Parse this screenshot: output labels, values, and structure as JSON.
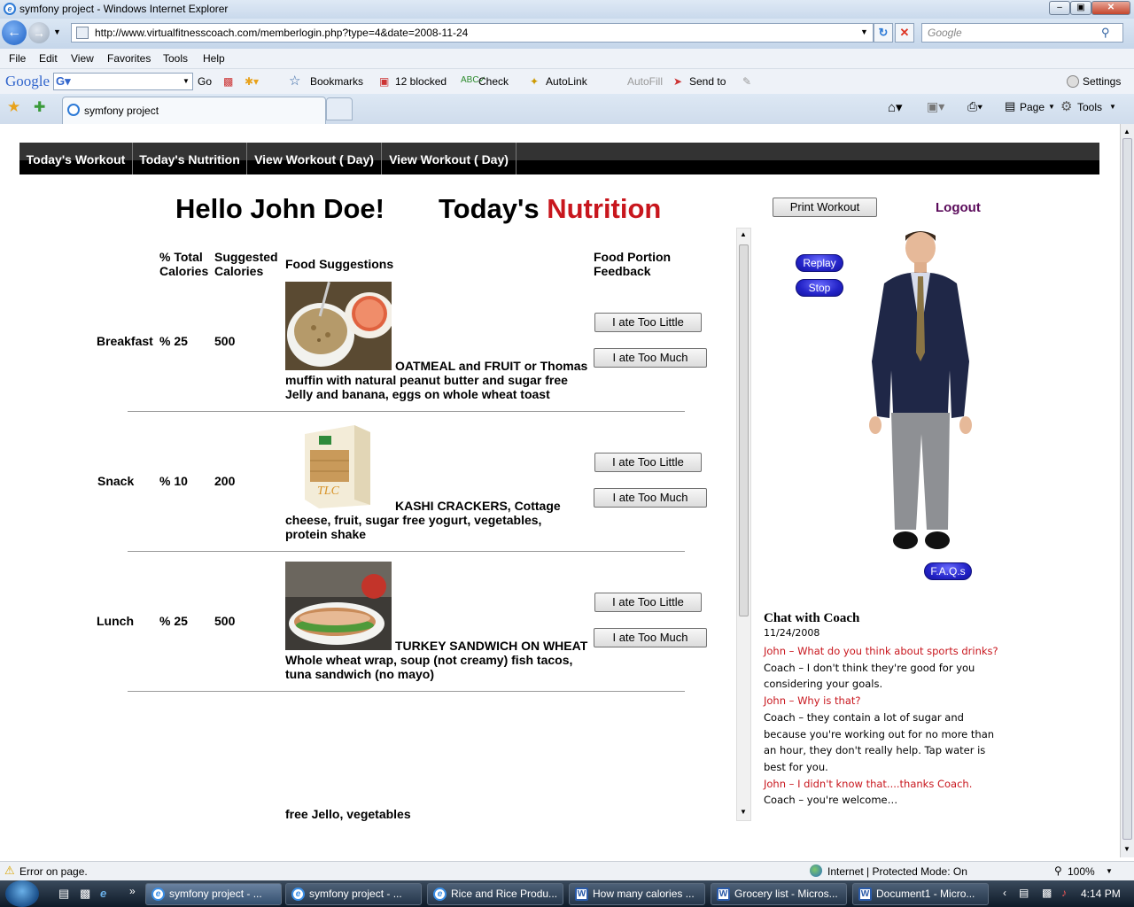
{
  "window": {
    "title": "symfony project - Windows Internet Explorer"
  },
  "address": {
    "url": "http://www.virtualfitnesscoach.com/memberlogin.php?type=4&date=2008-11-24",
    "search_placeholder": "Google"
  },
  "menu": [
    "File",
    "Edit",
    "View",
    "Favorites",
    "Tools",
    "Help"
  ],
  "google_toolbar": {
    "logo": "Google",
    "go": "Go",
    "bookmarks": "Bookmarks",
    "blocked": "12 blocked",
    "check": "Check",
    "autolink": "AutoLink",
    "autofill": "AutoFill",
    "sendto": "Send to",
    "settings": "Settings"
  },
  "tabs": {
    "active": "symfony project"
  },
  "command_bar": {
    "page": "Page",
    "tools": "Tools"
  },
  "site_nav": [
    "Today's Workout",
    "Today's Nutrition",
    "View Workout ( Day)",
    "View Workout ( Day)"
  ],
  "greeting": "Hello John Doe!",
  "heading": {
    "prefix": "Today's",
    "accent": "Nutrition",
    "accent_color": "#c8161d"
  },
  "print_button": "Print Workout",
  "logout": "Logout",
  "columns": {
    "pct": [
      "% Total",
      "Calories"
    ],
    "suggested": [
      "Suggested",
      "Calories"
    ],
    "food": "Food Suggestions",
    "feedback": [
      "Food Portion",
      "Feedback"
    ]
  },
  "meals": [
    {
      "name": "Breakfast",
      "pct": "% 25",
      "calories": "500",
      "image": "oatmeal-and-grapefruit",
      "lines": [
        "OATMEAL and FRUIT or Thomas",
        "muffin with natural peanut butter and sugar free",
        "Jelly and banana, eggs on whole wheat toast"
      ],
      "too_little": "I ate Too Little",
      "too_much": "I ate Too Much"
    },
    {
      "name": "Snack",
      "pct": "% 10",
      "calories": "200",
      "image": "kashi-tlc-crackers-box",
      "lines": [
        "KASHI CRACKERS, Cottage",
        "cheese, fruit, sugar free yogurt, vegetables,",
        "protein shake"
      ],
      "too_little": "I ate Too Little",
      "too_much": "I ate Too Much"
    },
    {
      "name": "Lunch",
      "pct": "% 25",
      "calories": "500",
      "image": "turkey-sandwich-and-apple",
      "lines": [
        "TURKEY SANDWICH ON WHEAT",
        "Whole wheat wrap, soup (not creamy) fish tacos,",
        "tuna sandwich (no mayo)"
      ],
      "too_little": "I ate Too Little",
      "too_much": "I ate Too Much"
    }
  ],
  "partial_row_text": "free Jello, vegetables",
  "coach_controls": {
    "replay": "Replay",
    "stop": "Stop",
    "faqs": "F.A.Q.s"
  },
  "chat": {
    "title": "Chat with Coach",
    "date": "11/24/2008",
    "user_color": "#c8161d",
    "messages": [
      {
        "from": "user",
        "text": "John – What do you think about sports drinks?"
      },
      {
        "from": "coach",
        "text": "Coach – I don't think they're good for you considering your goals."
      },
      {
        "from": "user",
        "text": "John – Why is that?"
      },
      {
        "from": "coach",
        "text": "Coach – they contain a lot of sugar and because you're working out for no more than an hour, they don't really help.  Tap water is best for you."
      },
      {
        "from": "user",
        "text": "John – I didn't know that....thanks  Coach."
      },
      {
        "from": "coach",
        "text": "Coach – you're welcome…"
      }
    ]
  },
  "status": {
    "left": "Error on page.",
    "zone": "Internet | Protected Mode: On",
    "zoom": "100%"
  },
  "taskbar": {
    "items": [
      "symfony project - ...",
      "symfony project - ...",
      "Rice and Rice Produ...",
      "How many calories ...",
      "Grocery list - Micros...",
      "Document1 - Micro..."
    ],
    "clock": "4:14 PM"
  }
}
